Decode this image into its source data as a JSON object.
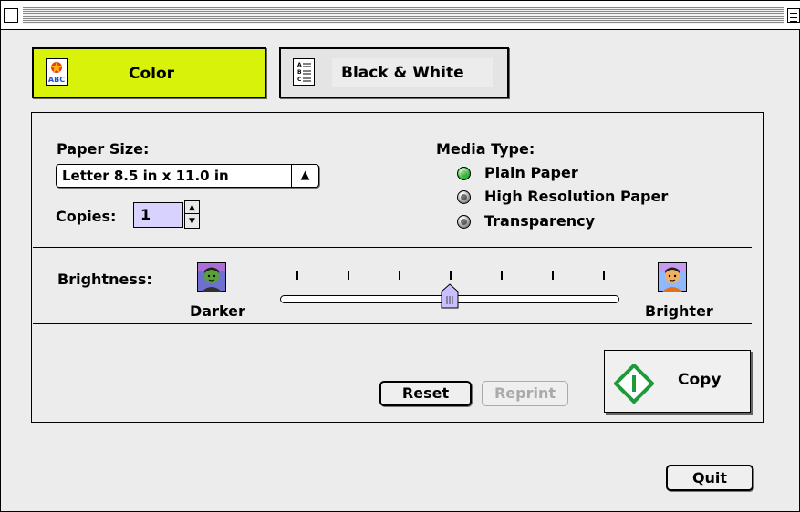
{
  "window": {
    "title": ""
  },
  "modes": {
    "color_label": "Color",
    "color_icon": "color-text-icon",
    "bw_label": "Black & White",
    "bw_icon": "bw-document-icon",
    "active": "Color"
  },
  "paper_size": {
    "label": "Paper Size:",
    "value": "Letter 8.5 in x 11.0 in"
  },
  "copies": {
    "label": "Copies:",
    "value": "1"
  },
  "media_type": {
    "label": "Media Type:",
    "options": [
      "Plain Paper",
      "High Resolution Paper",
      "Transparency"
    ],
    "selected": "Plain Paper"
  },
  "brightness": {
    "label": "Brightness:",
    "darker_label": "Darker",
    "brighter_label": "Brighter",
    "ticks": 7,
    "value_fraction": 0.5
  },
  "buttons": {
    "reset": "Reset",
    "reprint": "Reprint",
    "copy": "Copy",
    "quit": "Quit"
  },
  "colors": {
    "active_mode": "#d9f20a",
    "copies_field": "#d8d2ff",
    "radio_selected": "#38c040",
    "copy_icon": "#1f9a3a",
    "disabled_text": "#aaaaaa"
  }
}
